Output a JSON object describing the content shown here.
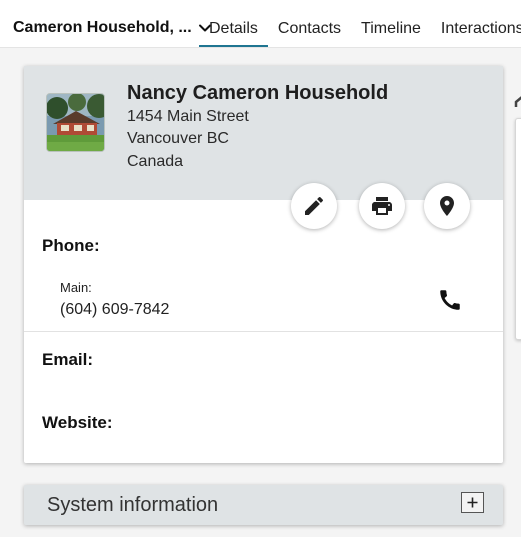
{
  "topbar": {
    "household_label": "Cameron Household, ...",
    "tabs": [
      {
        "label": "Details",
        "active": true
      },
      {
        "label": "Contacts",
        "active": false
      },
      {
        "label": "Timeline",
        "active": false
      },
      {
        "label": "Interactions",
        "active": false
      }
    ]
  },
  "card": {
    "name": "Nancy Cameron Household",
    "address": {
      "street": "1454 Main Street",
      "city_line": "Vancouver BC",
      "country": "Canada"
    },
    "actions": [
      {
        "name": "edit",
        "icon": "pencil-icon"
      },
      {
        "name": "print",
        "icon": "printer-icon"
      },
      {
        "name": "map",
        "icon": "map-pin-icon"
      }
    ],
    "phone": {
      "label": "Phone:",
      "type": "Main:",
      "number": "(604) 609-7842",
      "call_icon": "phone-icon"
    },
    "email_label": "Email:",
    "website_label": "Website:"
  },
  "system_info": {
    "title": "System information",
    "expand_icon": "plus-icon"
  },
  "colors": {
    "accent": "#1f7591",
    "header_bg": "#dfe3e5"
  }
}
